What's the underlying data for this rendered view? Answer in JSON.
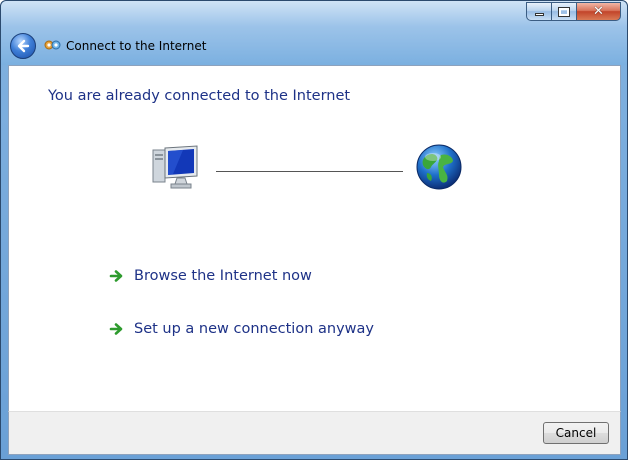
{
  "window": {
    "title": "Connect to the Internet",
    "caption_buttons": {
      "minimize": "",
      "maximize": "",
      "close": "✕"
    }
  },
  "main": {
    "heading": "You are already connected to the Internet",
    "icons": {
      "left": "computer-icon",
      "right": "globe-icon"
    },
    "options": [
      {
        "label": "Browse the Internet now",
        "icon": "green-arrow-icon"
      },
      {
        "label": "Set up a new connection anyway",
        "icon": "green-arrow-icon"
      }
    ]
  },
  "footer": {
    "cancel_label": "Cancel"
  },
  "colors": {
    "accent_text": "#1e3287",
    "titlebar": "#7bb0e0"
  }
}
